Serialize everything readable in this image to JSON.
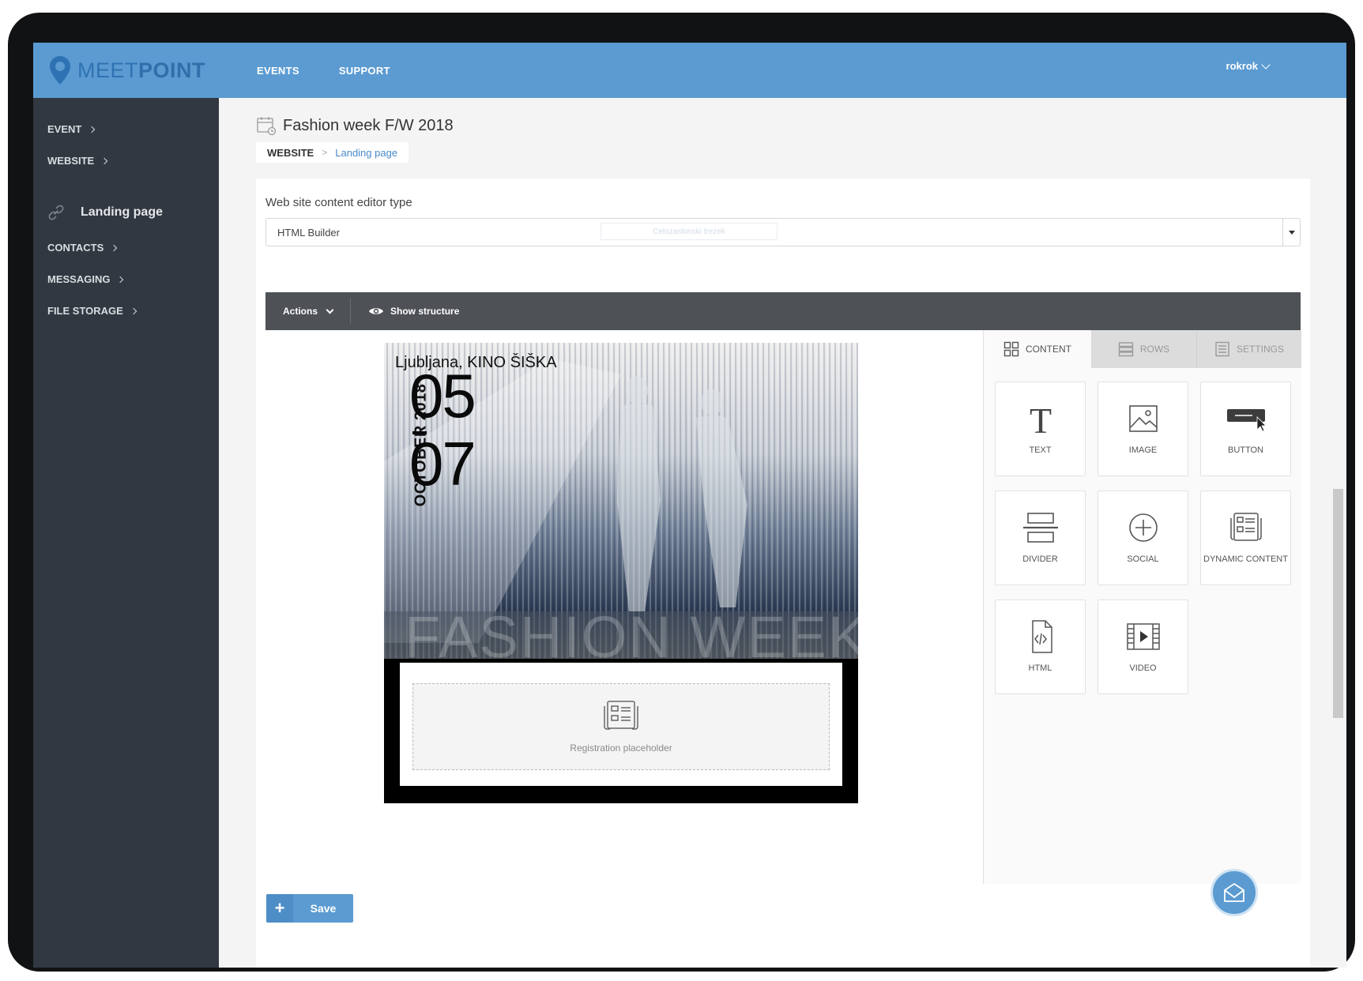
{
  "brand": {
    "name": "MEETPOINT",
    "name_part1": "MEET",
    "name_part2": "POINT"
  },
  "topnav": {
    "items": [
      "EVENTS",
      "SUPPORT"
    ],
    "user": "rokrok"
  },
  "sidebar": {
    "items": [
      {
        "label": "EVENT"
      },
      {
        "label": "WEBSITE"
      },
      {
        "label": "CONTACTS"
      },
      {
        "label": "MESSAGING"
      },
      {
        "label": "FILE STORAGE"
      }
    ],
    "active": {
      "label": "Landing page"
    }
  },
  "page": {
    "title": "Fashion week F/W 2018",
    "breadcrumb": {
      "root": "WEBSITE",
      "separator": ">",
      "current": "Landing page"
    }
  },
  "editor_type": {
    "label": "Web site content editor type",
    "value": "HTML Builder",
    "ghost_text": "Celozaslonski trezek"
  },
  "toolbar": {
    "actions": "Actions",
    "show_structure": "Show structure"
  },
  "poster": {
    "city": "Ljubljana, KINO ŠIŠKA",
    "month_year": "OCTOBER 2018",
    "day_start": "05",
    "day_end": "07",
    "overlay": "FASHION WEEK"
  },
  "registration": {
    "placeholder": "Registration placeholder"
  },
  "panel": {
    "tabs": [
      {
        "label": "CONTENT",
        "icon": "grid-icon"
      },
      {
        "label": "ROWS",
        "icon": "rows-icon"
      },
      {
        "label": "SETTINGS",
        "icon": "settings-list-icon"
      }
    ],
    "tiles": [
      {
        "label": "TEXT",
        "icon": "text-icon"
      },
      {
        "label": "IMAGE",
        "icon": "image-icon"
      },
      {
        "label": "BUTTON",
        "icon": "button-icon"
      },
      {
        "label": "DIVIDER",
        "icon": "divider-icon"
      },
      {
        "label": "SOCIAL",
        "icon": "social-plus-icon"
      },
      {
        "label": "DYNAMIC CONTENT",
        "icon": "dynamic-content-icon"
      },
      {
        "label": "HTML",
        "icon": "html-file-icon"
      },
      {
        "label": "VIDEO",
        "icon": "video-icon"
      }
    ]
  },
  "save": {
    "label": "Save"
  },
  "colors": {
    "brand": "#5b9bd1",
    "sidebar": "#323841",
    "toolbar": "#4e5257",
    "link": "#4a89c9"
  }
}
